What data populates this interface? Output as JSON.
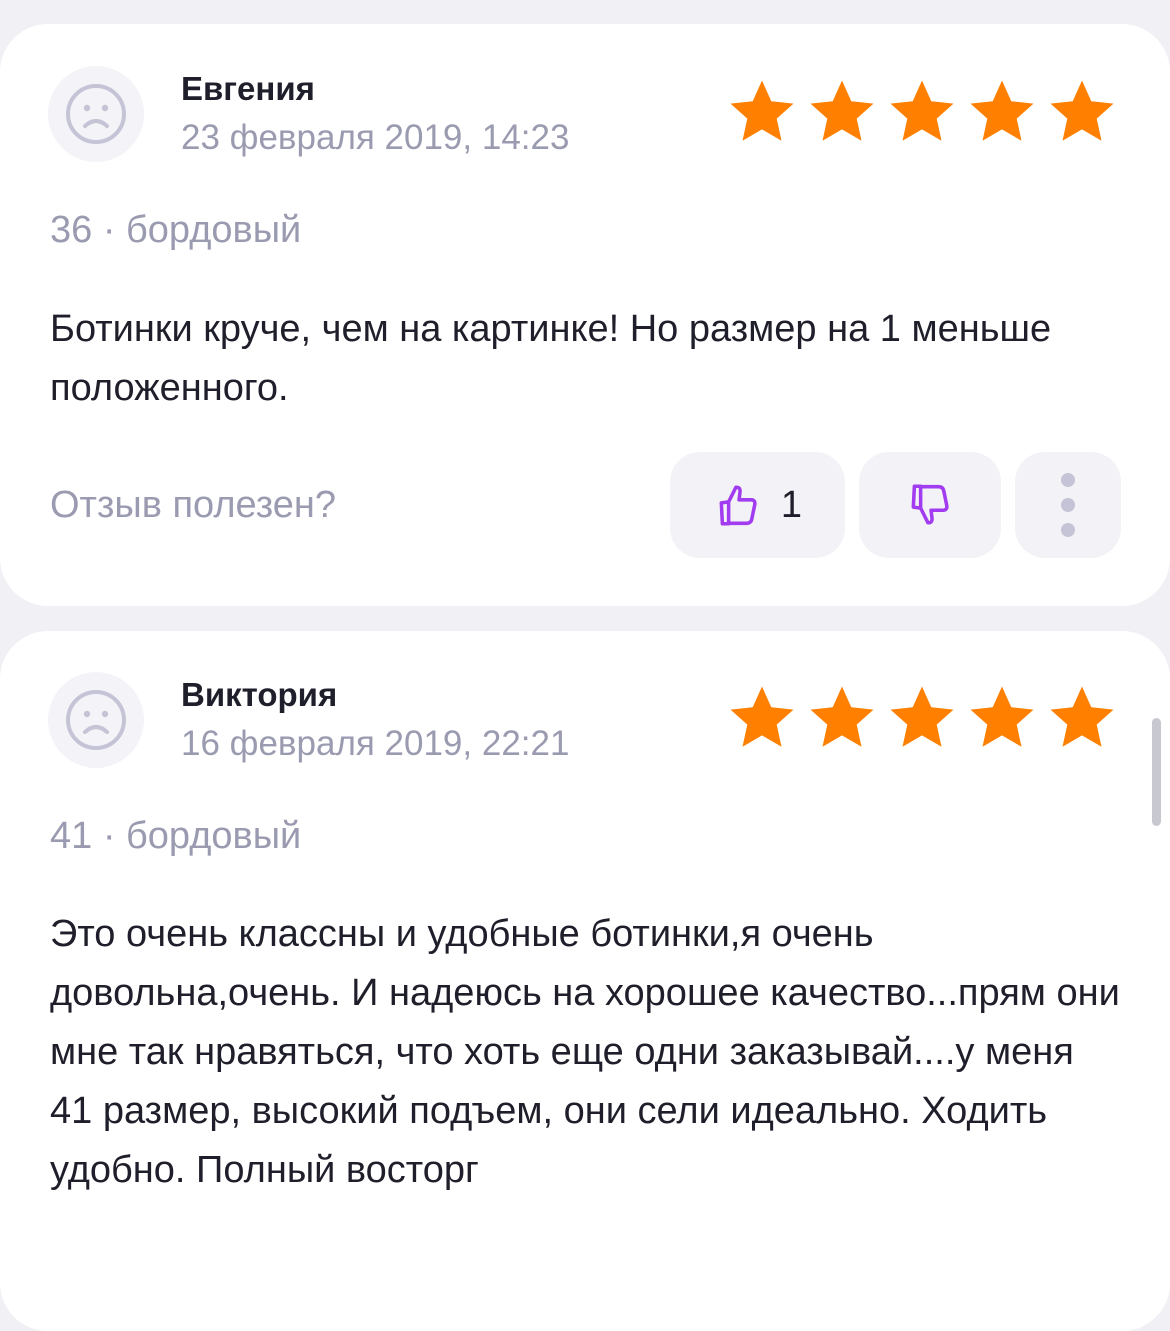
{
  "colors": {
    "star": "#ff7f00",
    "accent_purple": "#a23cf0",
    "muted_text": "#9a9ab0",
    "main_text": "#1f1f2b",
    "card_bg": "#ffffff",
    "page_bg": "#f0f0f5"
  },
  "reviews": [
    {
      "author": "Евгения",
      "date": "23 февраля 2019, 14:23",
      "rating": 5,
      "variant": "36 · бордовый",
      "text": "Ботинки круче, чем на картинке! Но размер на 1 меньше положенного.",
      "helpful_label": "Отзыв полезен?",
      "likes": "1",
      "avatar_icon": "sad-face-icon",
      "like_icon": "thumbs-up-icon",
      "dislike_icon": "thumbs-down-icon",
      "more_icon": "more-vertical-icon"
    },
    {
      "author": "Виктория",
      "date": "16 февраля 2019, 22:21",
      "rating": 5,
      "variant": "41 · бордовый",
      "text": "Это очень классны и удобные ботинки,я очень довольна,очень. И надеюсь на хорошее качество...прям они мне так нравяться, что хоть еще одни заказывай....у меня 41 размер, высокий подъем, они сели идеально. Ходить удобно. Полный восторг",
      "avatar_icon": "sad-face-icon"
    }
  ]
}
